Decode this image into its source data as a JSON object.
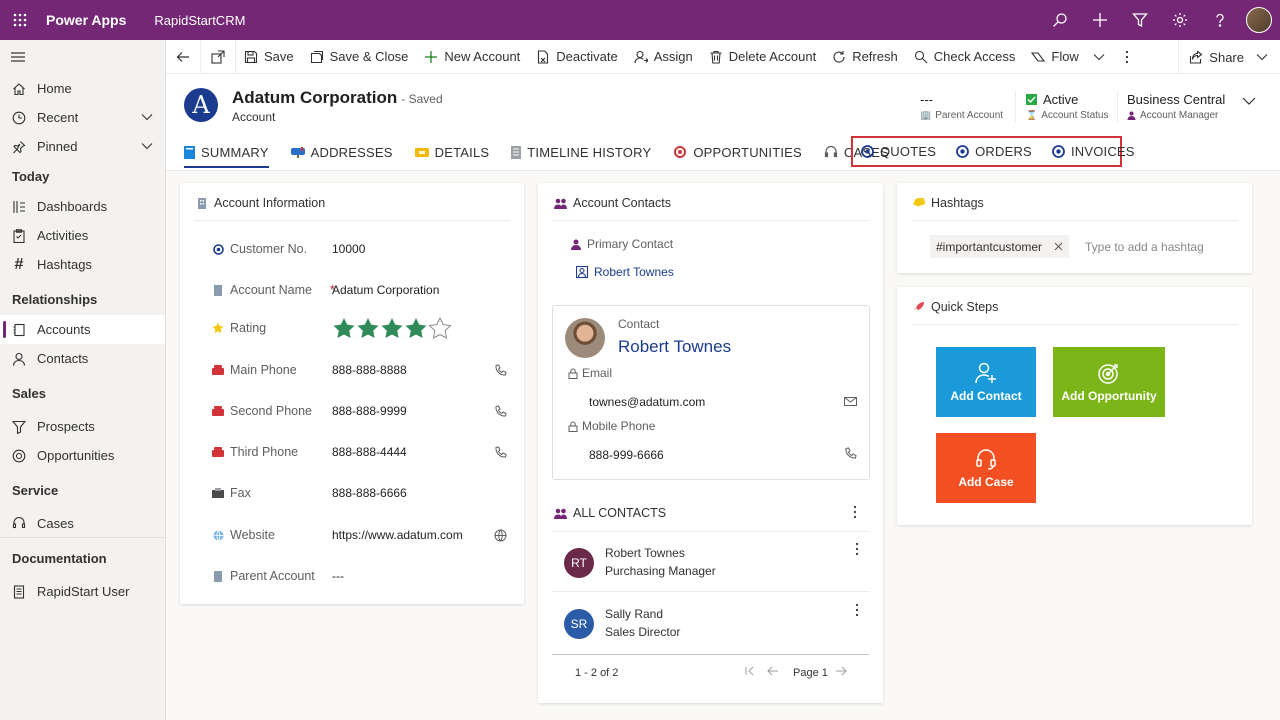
{
  "topbar": {
    "brand": "Power Apps",
    "app_name": "RapidStartCRM"
  },
  "sidebar": {
    "items_top": [
      {
        "label": "Home"
      },
      {
        "label": "Recent"
      },
      {
        "label": "Pinned"
      }
    ],
    "sections": {
      "today": "Today",
      "relationships": "Relationships",
      "sales": "Sales",
      "service": "Service",
      "documentation": "Documentation"
    },
    "today_items": [
      {
        "label": "Dashboards"
      },
      {
        "label": "Activities"
      },
      {
        "label": "Hashtags"
      }
    ],
    "relationship_items": [
      {
        "label": "Accounts"
      },
      {
        "label": "Contacts"
      }
    ],
    "sales_items": [
      {
        "label": "Prospects"
      },
      {
        "label": "Opportunities"
      }
    ],
    "service_items": [
      {
        "label": "Cases"
      }
    ],
    "documentation_items": [
      {
        "label": "RapidStart User"
      }
    ]
  },
  "commands": {
    "save": "Save",
    "save_close": "Save & Close",
    "new_account": "New Account",
    "deactivate": "Deactivate",
    "assign": "Assign",
    "delete_account": "Delete Account",
    "refresh": "Refresh",
    "check_access": "Check Access",
    "flow": "Flow",
    "share": "Share"
  },
  "record": {
    "logo_letter": "A",
    "title": "Adatum Corporation",
    "saved": "- Saved",
    "type": "Account",
    "parent_account_value": "---",
    "parent_account_label": "Parent Account",
    "status_value": "Active",
    "status_label": "Account Status",
    "manager_value": "Business Central",
    "manager_label": "Account Manager"
  },
  "tabs": [
    "SUMMARY",
    "ADDRESSES",
    "DETAILS",
    "TIMELINE HISTORY",
    "OPPORTUNITIES",
    "CASES",
    "QUOTES",
    "ORDERS",
    "INVOICES"
  ],
  "account_info": {
    "title": "Account Information",
    "fields": [
      {
        "label": "Customer No.",
        "value": "10000"
      },
      {
        "label": "Account Name",
        "value": "Adatum Corporation"
      },
      {
        "label": "Rating",
        "value": ""
      },
      {
        "label": "Main Phone",
        "value": "888-888-8888"
      },
      {
        "label": "Second Phone",
        "value": "888-888-9999"
      },
      {
        "label": "Third Phone",
        "value": "888-888-4444"
      },
      {
        "label": "Fax",
        "value": "888-888-6666"
      },
      {
        "label": "Website",
        "value": "https://www.adatum.com"
      },
      {
        "label": "Parent Account",
        "value": "---"
      }
    ],
    "rating": 4,
    "rating_max": 5
  },
  "account_contacts": {
    "title": "Account Contacts",
    "primary_label": "Primary Contact",
    "primary_name": "Robert Townes",
    "card": {
      "caption": "Contact",
      "name": "Robert Townes",
      "email_label": "Email",
      "email": "townes@adatum.com",
      "mobile_label": "Mobile Phone",
      "mobile": "888-999-6666"
    },
    "all_title": "ALL CONTACTS",
    "list": [
      {
        "initials": "RT",
        "name": "Robert Townes",
        "title": "Purchasing Manager",
        "color": "#6b2a4a"
      },
      {
        "initials": "SR",
        "name": "Sally Rand",
        "title": "Sales Director",
        "color": "#2b5aa6"
      }
    ],
    "paging_count": "1 - 2 of 2",
    "paging_page": "Page 1"
  },
  "hashtags": {
    "title": "Hashtags",
    "chip": "#importantcustomer",
    "placeholder": "Type to add a hashtag"
  },
  "quick_steps": {
    "title": "Quick Steps",
    "tiles": [
      {
        "label": "Add Contact",
        "color": "#1a9ad9"
      },
      {
        "label": "Add Opportunity",
        "color": "#7cb518"
      },
      {
        "label": "Add Case",
        "color": "#f25022"
      }
    ]
  },
  "colors": {
    "brand": "#742774",
    "accent": "#1b3b8f",
    "highlight_box": "#d13438",
    "status_green": "#2aa745"
  }
}
